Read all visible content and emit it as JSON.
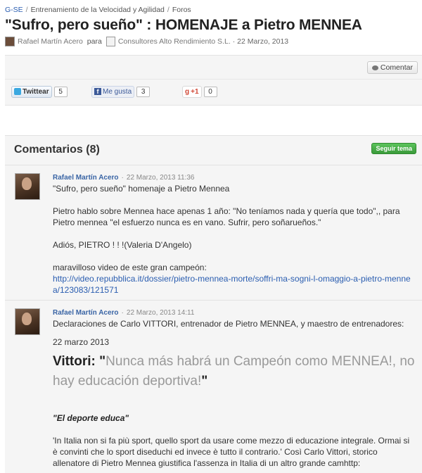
{
  "breadcrumb": {
    "items": [
      "G-SE",
      "Entrenamiento de la Velocidad y Agilidad",
      "Foros"
    ],
    "separator": "/"
  },
  "post": {
    "title": "\"Sufro, pero sueño\" : HOMENAJE a Pietro MENNEA",
    "author": "Rafael Martín Acero",
    "para_label": "para",
    "organization": "Consultores Alto Rendimiento S.L.",
    "date": "22 Marzo, 2013"
  },
  "share": {
    "comment_label": "Comentar",
    "twitter": {
      "label": "Twittear",
      "count": "5"
    },
    "facebook": {
      "label": "Me gusta",
      "count": "3"
    },
    "gplus": {
      "label": "+1",
      "count": "0"
    }
  },
  "comments": {
    "title": "Comentarios (8)",
    "follow_label": "Seguir tema",
    "items": [
      {
        "author": "Rafael Martín Acero",
        "timestamp": "22 Marzo, 2013 11:36",
        "line1": "\"Sufro, pero sueño\" homenaje a Pietro Mennea",
        "p2": "Pietro hablo sobre Mennea hace apenas 1 año: \"No teníamos nada y quería que todo\",, para Pietro mennea \"el esfuerzo nunca es en vano. Sufrir, pero soñarueños.\"",
        "p3": "Adiós, PIETRO ! ! !(Valeria D'Angelo)",
        "p4": "maravilloso video de este gran campeón:",
        "link": "http://video.repubblica.it/dossier/pietro-mennea-morte/soffri-ma-sogni-l-omaggio-a-pietro-mennea/123083/121571"
      },
      {
        "author": "Rafael Martín Acero",
        "timestamp": "22 Marzo, 2013 14:11",
        "line1": "Declaraciones de Carlo VITTORI, entrenador de Pietro MENNEA, y maestro de entrenadores:",
        "date": "22 marzo 2013",
        "quote_name": "Vittori:",
        "quote_open": "\"",
        "quote_text": "Nunca más habrá un Campeón como MENNEA!, no hay educación deportiva!",
        "quote_close": "\"",
        "subheading": "\"El deporte educa\"",
        "italian": "'In Italia non si fa più sport, quello sport da usare come mezzo di educazione integrale. Ormai si è convinti che lo sport diseduchi ed invece è tutto il contrario.' Così Carlo Vittori, storico allenatore di Pietro Mennea giustifica l'assenza in Italia di un altro grande camhttp:"
      }
    ]
  },
  "colors": {
    "link": "#2a5db0",
    "follow_button": "#3a9a3a",
    "panel_bg": "#f5f5f5"
  },
  "icons": [
    "author-avatar-icon",
    "document-icon",
    "speech-bubble-icon",
    "twitter-icon",
    "facebook-icon",
    "google-plus-icon"
  ]
}
